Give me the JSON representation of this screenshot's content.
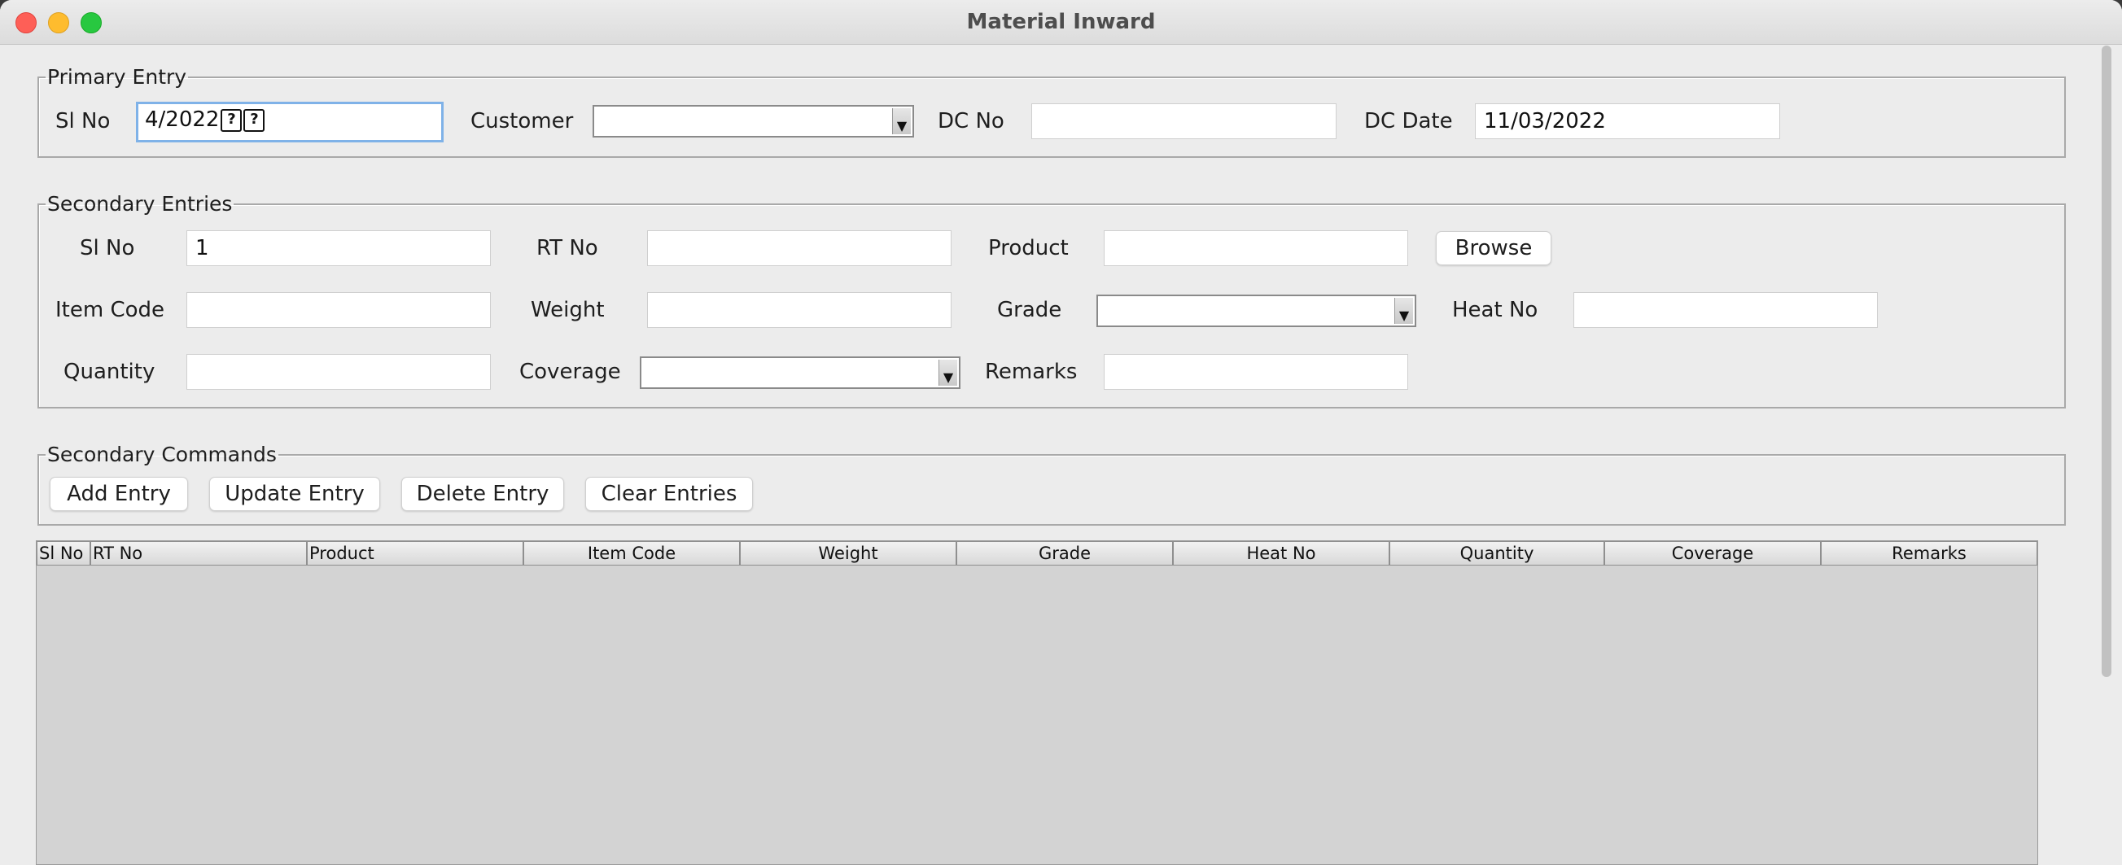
{
  "window": {
    "title": "Material Inward"
  },
  "primary": {
    "legend": "Primary Entry",
    "sl_no_label": "Sl No",
    "sl_no_value": "4/2022",
    "sl_no_glyph": "?",
    "customer_label": "Customer",
    "customer_value": "",
    "dc_no_label": "DC No",
    "dc_no_value": "",
    "dc_date_label": "DC Date",
    "dc_date_value": "11/03/2022"
  },
  "secondary": {
    "legend": "Secondary Entries",
    "sl_no_label": "Sl No",
    "sl_no_value": "1",
    "rt_no_label": "RT No",
    "rt_no_value": "",
    "product_label": "Product",
    "product_value": "",
    "browse_label": "Browse",
    "item_code_label": "Item Code",
    "item_code_value": "",
    "weight_label": "Weight",
    "weight_value": "",
    "grade_label": "Grade",
    "grade_value": "",
    "heat_no_label": "Heat No",
    "heat_no_value": "",
    "quantity_label": "Quantity",
    "quantity_value": "",
    "coverage_label": "Coverage",
    "coverage_value": "",
    "remarks_label": "Remarks",
    "remarks_value": ""
  },
  "commands": {
    "legend": "Secondary Commands",
    "add": "Add Entry",
    "update": "Update Entry",
    "delete": "Delete Entry",
    "clear": "Clear Entries"
  },
  "table": {
    "columns": [
      "Sl No",
      "RT No",
      "Product",
      "Item Code",
      "Weight",
      "Grade",
      "Heat No",
      "Quantity",
      "Coverage",
      "Remarks"
    ],
    "rows": []
  },
  "colors": {
    "focus_ring": "#7fb2e8",
    "close": "#fe5f57",
    "minimize": "#febc2e",
    "maximize": "#28c840",
    "table_bg": "#d3d3d3"
  }
}
